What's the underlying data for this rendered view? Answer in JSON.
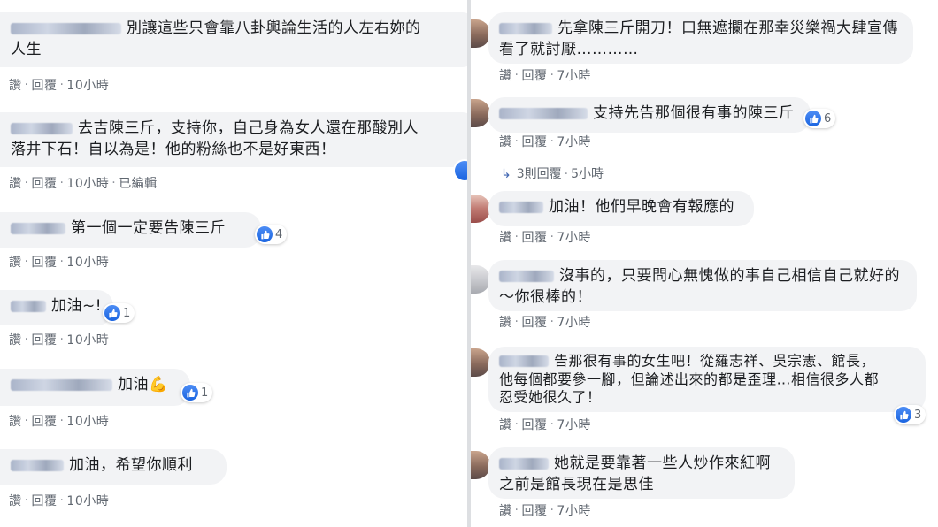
{
  "actions": {
    "like": "讚",
    "reply": "回覆",
    "edited": "已編輯",
    "separator": "·"
  },
  "left": [
    {
      "text": "別讓這些只會靠八卦輿論生活的人左右妳的\n人生",
      "time": "10小時"
    },
    {
      "text": "去吉陳三斤，支持你，自己身為女人還在那酸別人\n落井下石！自以為是！他的粉絲也不是好東西！",
      "time": "10小時",
      "edited": true
    },
    {
      "text": "第一個一定要告陳三斤",
      "time": "10小時",
      "likes": "4"
    },
    {
      "text": "加油~!",
      "time": "10小時",
      "likes": "1"
    },
    {
      "text": "加油",
      "emoji": "💪",
      "time": "10小時",
      "likes": "1"
    },
    {
      "text": "加油，希望你順利",
      "time": "10小時"
    }
  ],
  "right": [
    {
      "text": "先拿陳三斤開刀！口無遮攔在那幸災樂禍大肆宣傳\n看了就討厭…………",
      "time": "7小時"
    },
    {
      "text": "支持先告那個很有事的陳三斤",
      "time": "7小時",
      "likes": "6",
      "replies": "3則回覆",
      "replies_time": "5小時"
    },
    {
      "text": "加油！他們早晚會有報應的",
      "time": "7小時"
    },
    {
      "text": "沒事的，只要問心無愧做的事自己相信自己就好的\n～你很棒的！",
      "time": "7小時"
    },
    {
      "text": "告那很有事的女生吧！從羅志祥、吳宗憲、館長，\n他每個都要參一腳，但論述出來的都是歪理…相信很多人都\n忍受她很久了！",
      "time": "7小時",
      "likes": "3"
    },
    {
      "text": "她就是要靠著一些人炒作來紅啊\n之前是館長現在是思佳",
      "time": "7小時"
    }
  ]
}
